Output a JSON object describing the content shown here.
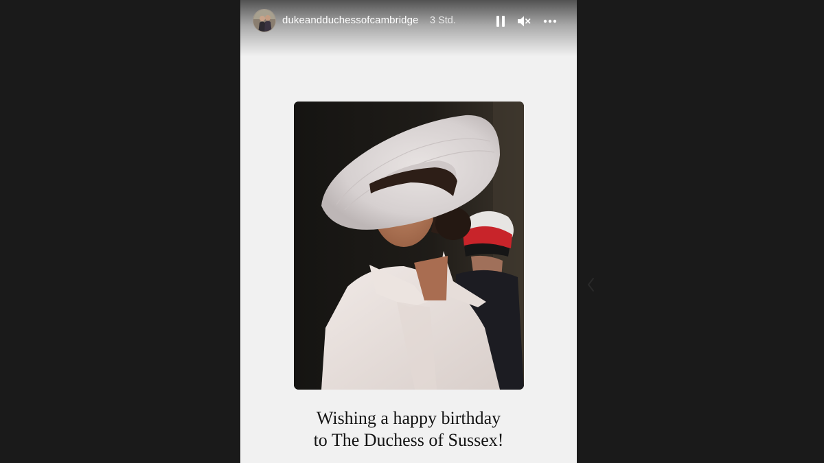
{
  "story": {
    "username": "dukeandduchessofcambridge",
    "timestamp": "3 Std.",
    "controls": {
      "pause_icon": "pause-icon",
      "mute_icon": "speaker-muted-icon",
      "more_icon": "more-horizontal-icon"
    },
    "caption": {
      "line1": "Wishing a happy birthday",
      "line2": "to The Duchess of Sussex!"
    }
  },
  "colors": {
    "page_background": "#1a1a1a",
    "story_background": "#f1f1f1",
    "caption_text": "#141414",
    "header_text": "#ffffff"
  }
}
